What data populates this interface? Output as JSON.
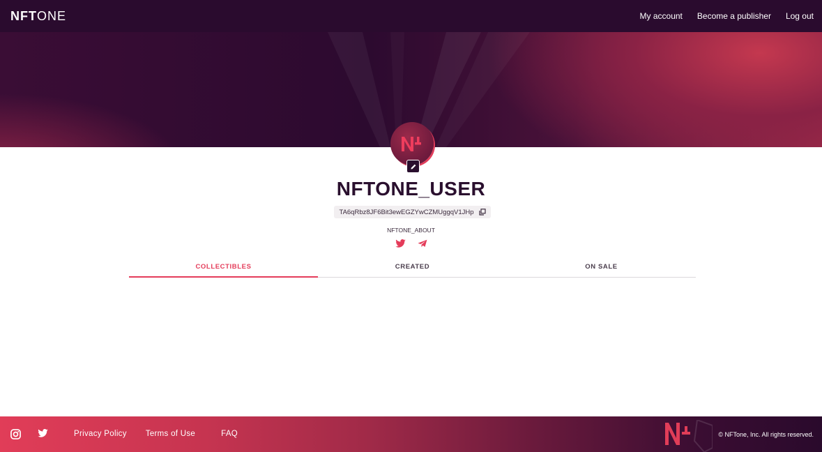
{
  "header": {
    "logo_part1": "NFT",
    "logo_part2": "ONE",
    "nav": {
      "my_account": "My account",
      "become_publisher": "Become a publisher",
      "log_out": "Log out"
    }
  },
  "profile": {
    "avatar_icon": "nftone-logo-icon",
    "edit_icon": "pencil-icon",
    "username": "NFTONE_USER",
    "address": "TA6qRbz8JF6Bit3ewEGZYwCZMUggqV1JHp",
    "about": "NFTONE_ABOUT",
    "socials": [
      "twitter-icon",
      "telegram-icon"
    ]
  },
  "tabs": [
    {
      "label": "COLLECTIBLES",
      "active": true
    },
    {
      "label": "CREATED",
      "active": false
    },
    {
      "label": "ON SALE",
      "active": false
    }
  ],
  "footer": {
    "icons": [
      "instagram-icon",
      "twitter-icon"
    ],
    "links": {
      "privacy": "Privacy Policy",
      "terms": "Terms of Use",
      "faq": "FAQ"
    },
    "copyright": "© NFTone, Inc. All rights reserved."
  },
  "colors": {
    "accent": "#e43c5a",
    "dark": "#2a0b2e",
    "text_dark": "#2a0f2e"
  }
}
